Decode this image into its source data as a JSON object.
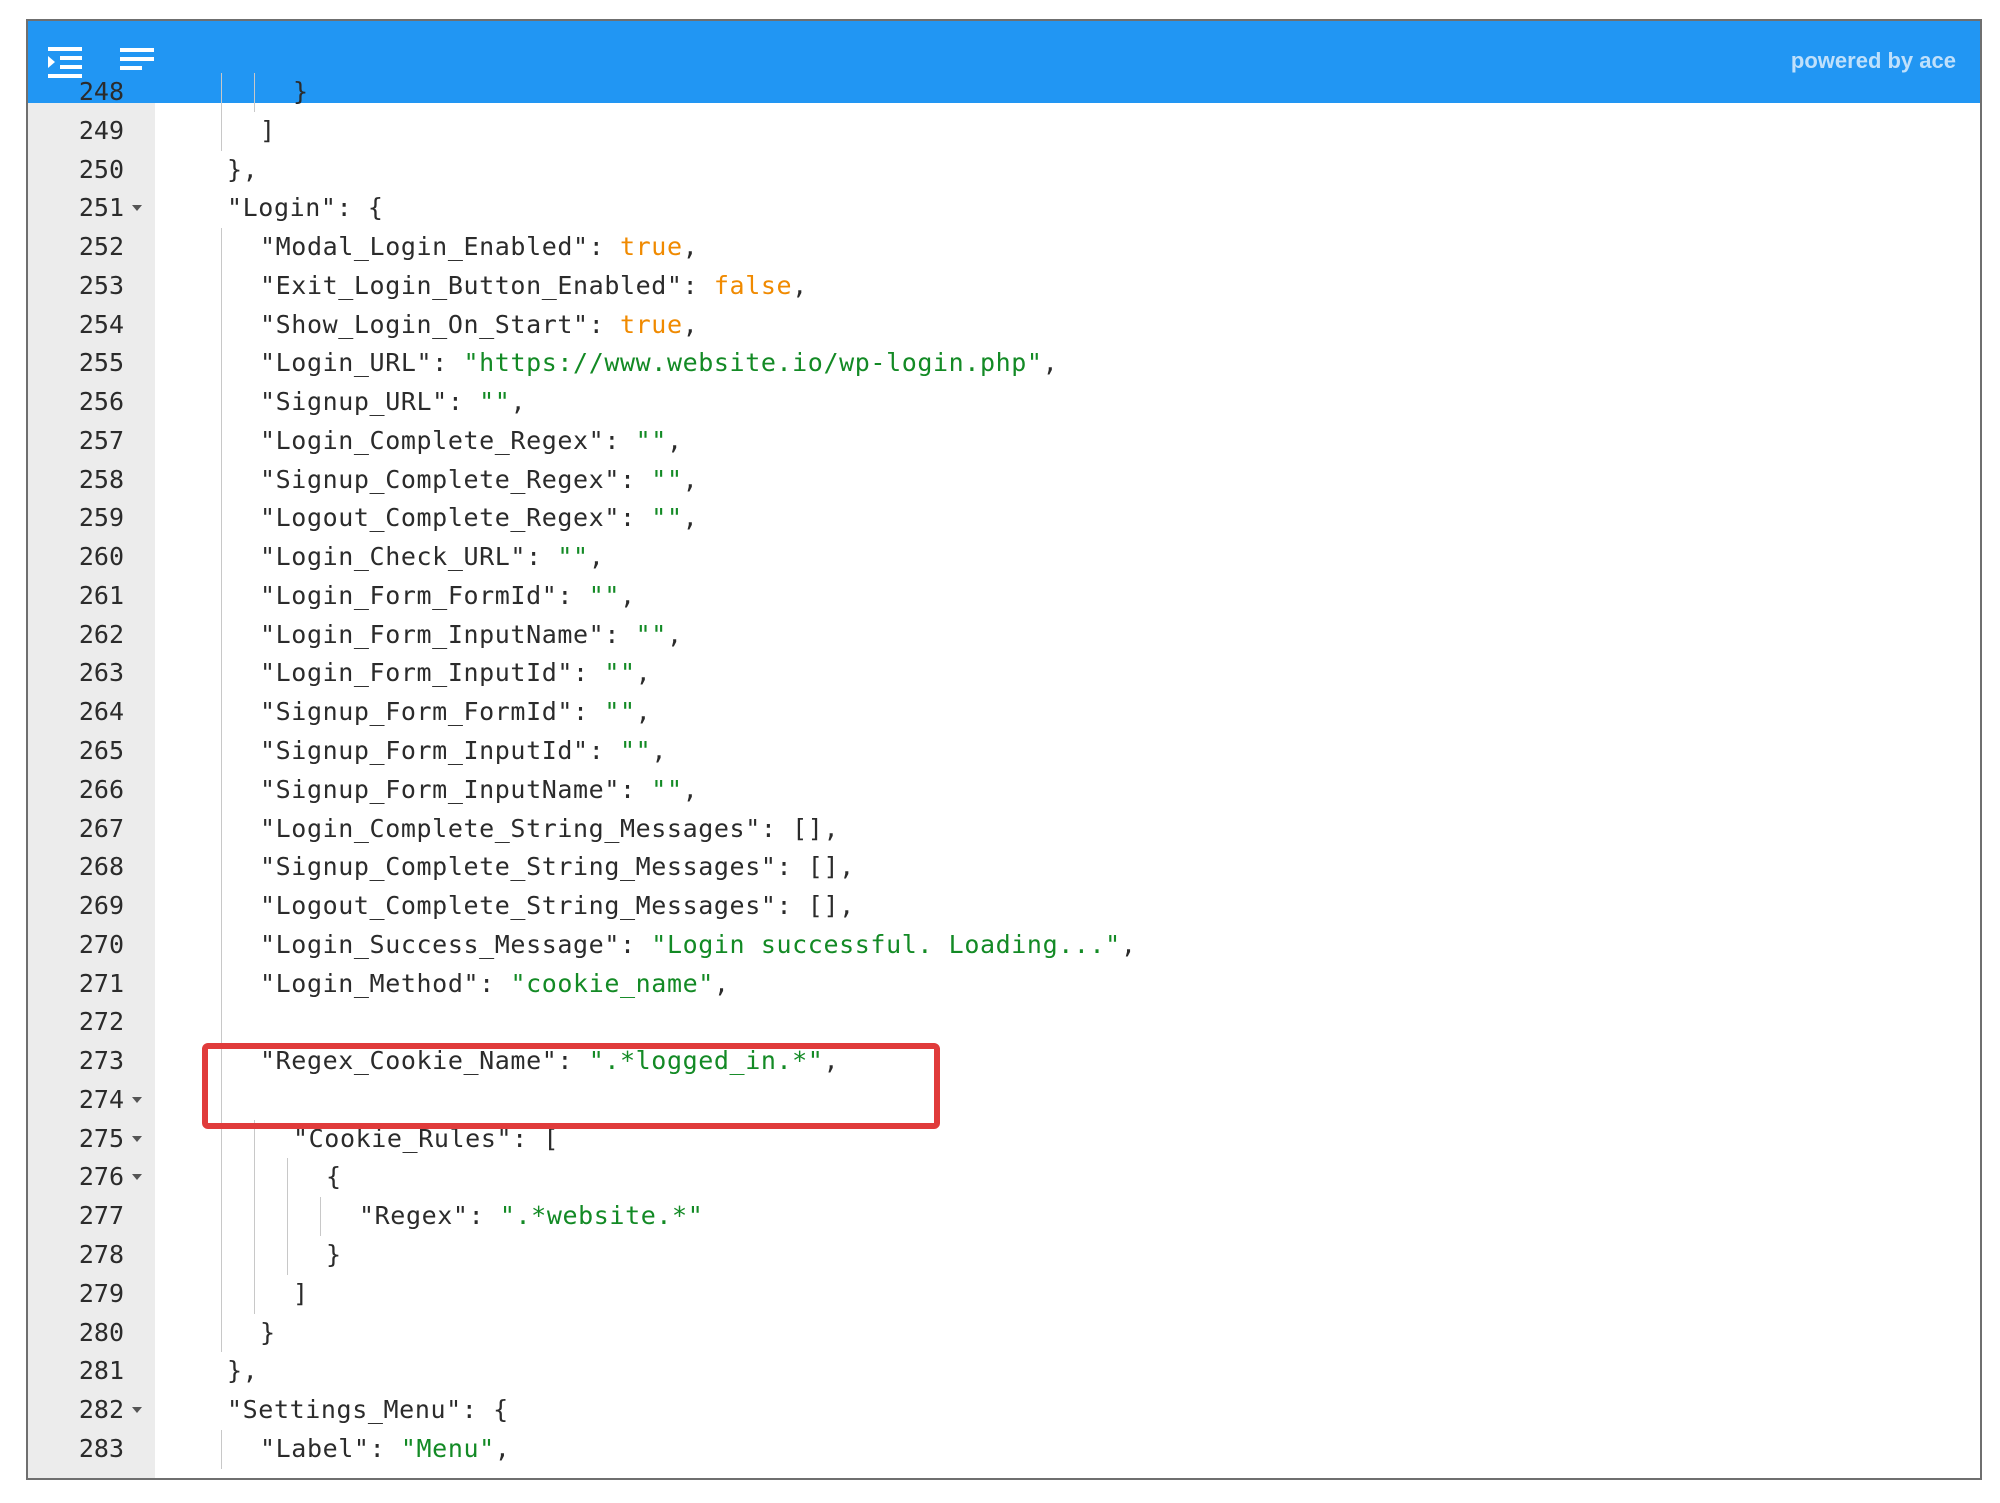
{
  "toolbar": {
    "left_icons": [
      "indent-list-icon",
      "text-lines-icon"
    ],
    "powered_by": "powered by ace",
    "background_color": "#2196f3"
  },
  "colors": {
    "key": "#2b2b2b",
    "string": "#138a25",
    "boolean": "#f08a00",
    "highlight_box": "#e03b3b"
  },
  "editor": {
    "lines": [
      {
        "num": "248",
        "fold": false,
        "indent": 3,
        "tokens": [
          {
            "t": "p",
            "v": "}"
          }
        ]
      },
      {
        "num": "249",
        "fold": false,
        "indent": 2,
        "tokens": [
          {
            "t": "p",
            "v": "]"
          }
        ]
      },
      {
        "num": "250",
        "fold": false,
        "indent": 1,
        "tokens": [
          {
            "t": "p",
            "v": "},"
          }
        ]
      },
      {
        "num": "251",
        "fold": true,
        "indent": 1,
        "tokens": [
          {
            "t": "k",
            "v": "\"Login\""
          },
          {
            "t": "p",
            "v": ": {"
          }
        ]
      },
      {
        "num": "252",
        "fold": false,
        "indent": 2,
        "tokens": [
          {
            "t": "k",
            "v": "\"Modal_Login_Enabled\""
          },
          {
            "t": "p",
            "v": ": "
          },
          {
            "t": "b",
            "v": "true"
          },
          {
            "t": "p",
            "v": ","
          }
        ]
      },
      {
        "num": "253",
        "fold": false,
        "indent": 2,
        "tokens": [
          {
            "t": "k",
            "v": "\"Exit_Login_Button_Enabled\""
          },
          {
            "t": "p",
            "v": ": "
          },
          {
            "t": "b",
            "v": "false"
          },
          {
            "t": "p",
            "v": ","
          }
        ]
      },
      {
        "num": "254",
        "fold": false,
        "indent": 2,
        "tokens": [
          {
            "t": "k",
            "v": "\"Show_Login_On_Start\""
          },
          {
            "t": "p",
            "v": ": "
          },
          {
            "t": "b",
            "v": "true"
          },
          {
            "t": "p",
            "v": ","
          }
        ]
      },
      {
        "num": "255",
        "fold": false,
        "indent": 2,
        "tokens": [
          {
            "t": "k",
            "v": "\"Login_URL\""
          },
          {
            "t": "p",
            "v": ": "
          },
          {
            "t": "s",
            "v": "\"https://www.website.io/wp-login.php\""
          },
          {
            "t": "p",
            "v": ","
          }
        ]
      },
      {
        "num": "256",
        "fold": false,
        "indent": 2,
        "tokens": [
          {
            "t": "k",
            "v": "\"Signup_URL\""
          },
          {
            "t": "p",
            "v": ": "
          },
          {
            "t": "s",
            "v": "\"\""
          },
          {
            "t": "p",
            "v": ","
          }
        ]
      },
      {
        "num": "257",
        "fold": false,
        "indent": 2,
        "tokens": [
          {
            "t": "k",
            "v": "\"Login_Complete_Regex\""
          },
          {
            "t": "p",
            "v": ": "
          },
          {
            "t": "s",
            "v": "\"\""
          },
          {
            "t": "p",
            "v": ","
          }
        ]
      },
      {
        "num": "258",
        "fold": false,
        "indent": 2,
        "tokens": [
          {
            "t": "k",
            "v": "\"Signup_Complete_Regex\""
          },
          {
            "t": "p",
            "v": ": "
          },
          {
            "t": "s",
            "v": "\"\""
          },
          {
            "t": "p",
            "v": ","
          }
        ]
      },
      {
        "num": "259",
        "fold": false,
        "indent": 2,
        "tokens": [
          {
            "t": "k",
            "v": "\"Logout_Complete_Regex\""
          },
          {
            "t": "p",
            "v": ": "
          },
          {
            "t": "s",
            "v": "\"\""
          },
          {
            "t": "p",
            "v": ","
          }
        ]
      },
      {
        "num": "260",
        "fold": false,
        "indent": 2,
        "tokens": [
          {
            "t": "k",
            "v": "\"Login_Check_URL\""
          },
          {
            "t": "p",
            "v": ": "
          },
          {
            "t": "s",
            "v": "\"\""
          },
          {
            "t": "p",
            "v": ","
          }
        ]
      },
      {
        "num": "261",
        "fold": false,
        "indent": 2,
        "tokens": [
          {
            "t": "k",
            "v": "\"Login_Form_FormId\""
          },
          {
            "t": "p",
            "v": ": "
          },
          {
            "t": "s",
            "v": "\"\""
          },
          {
            "t": "p",
            "v": ","
          }
        ]
      },
      {
        "num": "262",
        "fold": false,
        "indent": 2,
        "tokens": [
          {
            "t": "k",
            "v": "\"Login_Form_InputName\""
          },
          {
            "t": "p",
            "v": ": "
          },
          {
            "t": "s",
            "v": "\"\""
          },
          {
            "t": "p",
            "v": ","
          }
        ]
      },
      {
        "num": "263",
        "fold": false,
        "indent": 2,
        "tokens": [
          {
            "t": "k",
            "v": "\"Login_Form_InputId\""
          },
          {
            "t": "p",
            "v": ": "
          },
          {
            "t": "s",
            "v": "\"\""
          },
          {
            "t": "p",
            "v": ","
          }
        ]
      },
      {
        "num": "264",
        "fold": false,
        "indent": 2,
        "tokens": [
          {
            "t": "k",
            "v": "\"Signup_Form_FormId\""
          },
          {
            "t": "p",
            "v": ": "
          },
          {
            "t": "s",
            "v": "\"\""
          },
          {
            "t": "p",
            "v": ","
          }
        ]
      },
      {
        "num": "265",
        "fold": false,
        "indent": 2,
        "tokens": [
          {
            "t": "k",
            "v": "\"Signup_Form_InputId\""
          },
          {
            "t": "p",
            "v": ": "
          },
          {
            "t": "s",
            "v": "\"\""
          },
          {
            "t": "p",
            "v": ","
          }
        ]
      },
      {
        "num": "266",
        "fold": false,
        "indent": 2,
        "tokens": [
          {
            "t": "k",
            "v": "\"Signup_Form_InputName\""
          },
          {
            "t": "p",
            "v": ": "
          },
          {
            "t": "s",
            "v": "\"\""
          },
          {
            "t": "p",
            "v": ","
          }
        ]
      },
      {
        "num": "267",
        "fold": false,
        "indent": 2,
        "tokens": [
          {
            "t": "k",
            "v": "\"Login_Complete_String_Messages\""
          },
          {
            "t": "p",
            "v": ": [],"
          }
        ]
      },
      {
        "num": "268",
        "fold": false,
        "indent": 2,
        "tokens": [
          {
            "t": "k",
            "v": "\"Signup_Complete_String_Messages\""
          },
          {
            "t": "p",
            "v": ": [],"
          }
        ]
      },
      {
        "num": "269",
        "fold": false,
        "indent": 2,
        "tokens": [
          {
            "t": "k",
            "v": "\"Logout_Complete_String_Messages\""
          },
          {
            "t": "p",
            "v": ": [],"
          }
        ]
      },
      {
        "num": "270",
        "fold": false,
        "indent": 2,
        "tokens": [
          {
            "t": "k",
            "v": "\"Login_Success_Message\""
          },
          {
            "t": "p",
            "v": ": "
          },
          {
            "t": "s",
            "v": "\"Login successful. Loading...\""
          },
          {
            "t": "p",
            "v": ","
          }
        ]
      },
      {
        "num": "271",
        "fold": false,
        "indent": 2,
        "tokens": [
          {
            "t": "k",
            "v": "\"Login_Method\""
          },
          {
            "t": "p",
            "v": ": "
          },
          {
            "t": "s",
            "v": "\"cookie_name\""
          },
          {
            "t": "p",
            "v": ","
          }
        ]
      },
      {
        "num": "272",
        "fold": false,
        "indent": 2,
        "tokens": []
      },
      {
        "num": "273",
        "fold": false,
        "indent": 2,
        "tokens": [
          {
            "t": "k",
            "v": "\"Regex_Cookie_Name\""
          },
          {
            "t": "p",
            "v": ": "
          },
          {
            "t": "s",
            "v": "\".*logged_in.*\""
          },
          {
            "t": "p",
            "v": ","
          }
        ]
      },
      {
        "num": "274",
        "fold": true,
        "indent": 2,
        "tokens": []
      },
      {
        "num": "275",
        "fold": true,
        "indent": 3,
        "tokens": [
          {
            "t": "k",
            "v": "\"Cookie_Rules\""
          },
          {
            "t": "p",
            "v": ": ["
          }
        ]
      },
      {
        "num": "276",
        "fold": true,
        "indent": 4,
        "tokens": [
          {
            "t": "p",
            "v": "{"
          }
        ]
      },
      {
        "num": "277",
        "fold": false,
        "indent": 5,
        "tokens": [
          {
            "t": "k",
            "v": "\"Regex\""
          },
          {
            "t": "p",
            "v": ": "
          },
          {
            "t": "s",
            "v": "\".*website.*\""
          }
        ]
      },
      {
        "num": "278",
        "fold": false,
        "indent": 4,
        "tokens": [
          {
            "t": "p",
            "v": "}"
          }
        ]
      },
      {
        "num": "279",
        "fold": false,
        "indent": 3,
        "tokens": [
          {
            "t": "p",
            "v": "]"
          }
        ]
      },
      {
        "num": "280",
        "fold": false,
        "indent": 2,
        "tokens": [
          {
            "t": "p",
            "v": "}"
          }
        ]
      },
      {
        "num": "281",
        "fold": false,
        "indent": 1,
        "tokens": [
          {
            "t": "p",
            "v": "},"
          }
        ]
      },
      {
        "num": "282",
        "fold": true,
        "indent": 1,
        "tokens": [
          {
            "t": "k",
            "v": "\"Settings_Menu\""
          },
          {
            "t": "p",
            "v": ": {"
          }
        ]
      },
      {
        "num": "283",
        "fold": false,
        "indent": 2,
        "tokens": [
          {
            "t": "k",
            "v": "\"Label\""
          },
          {
            "t": "p",
            "v": ": "
          },
          {
            "t": "s",
            "v": "\"Menu\""
          },
          {
            "t": "p",
            "v": ","
          }
        ]
      }
    ]
  }
}
